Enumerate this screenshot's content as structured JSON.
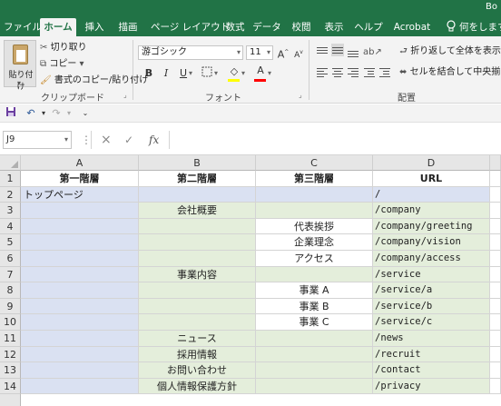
{
  "window": {
    "title": "Bo"
  },
  "tabs": [
    {
      "label": "ファイル"
    },
    {
      "label": "ホーム"
    },
    {
      "label": "挿入"
    },
    {
      "label": "描画"
    },
    {
      "label": "ページ レイアウト"
    },
    {
      "label": "数式"
    },
    {
      "label": "データ"
    },
    {
      "label": "校閲"
    },
    {
      "label": "表示"
    },
    {
      "label": "ヘルプ"
    },
    {
      "label": "Acrobat"
    },
    {
      "label": "何をしますか"
    }
  ],
  "active_tab": "ホーム",
  "ribbon": {
    "clipboard": {
      "paste_label": "貼り付け",
      "cut_label": "切り取り",
      "copy_label": "コピー",
      "format_painter_label": "書式のコピー/貼り付け",
      "group_label": "クリップボード"
    },
    "font": {
      "font_name": "游ゴシック",
      "font_size": "11",
      "bold": "B",
      "italic": "I",
      "underline": "U",
      "grow": "A",
      "shrink": "A",
      "font_color_label": "A",
      "group_label": "フォント",
      "highlight_color": "#ffff00",
      "font_color": "#ff0000"
    },
    "alignment": {
      "wrap_text_label": "折り返して全体を表示す",
      "merge_center_label": "セルを結合して中央揃え",
      "group_label": "配置"
    }
  },
  "formula_bar": {
    "name_box": "J9",
    "fx_label": "fx",
    "cancel_icon": "×",
    "enter_icon": "✓",
    "value": ""
  },
  "sheet": {
    "columns": [
      "A",
      "B",
      "C",
      "D"
    ],
    "rows": [
      "1",
      "2",
      "3",
      "4",
      "5",
      "6",
      "7",
      "8",
      "9",
      "10",
      "11",
      "12",
      "13",
      "14"
    ],
    "header_row": [
      "第一階層",
      "第二階層",
      "第三階層",
      "URL"
    ],
    "data": [
      [
        "トップページ",
        "",
        "",
        "/"
      ],
      [
        "",
        "会社概要",
        "",
        "/company"
      ],
      [
        "",
        "",
        "代表挨拶",
        "/company/greeting"
      ],
      [
        "",
        "",
        "企業理念",
        "/company/vision"
      ],
      [
        "",
        "",
        "アクセス",
        "/company/access"
      ],
      [
        "",
        "事業内容",
        "",
        "/service"
      ],
      [
        "",
        "",
        "事業 A",
        "/service/a"
      ],
      [
        "",
        "",
        "事業 B",
        "/service/b"
      ],
      [
        "",
        "",
        "事業 C",
        "/service/c"
      ],
      [
        "",
        "ニュース",
        "",
        "/news"
      ],
      [
        "",
        "採用情報",
        "",
        "/recruit"
      ],
      [
        "",
        "お問い合わせ",
        "",
        "/contact"
      ],
      [
        "",
        "個人情報保護方針",
        "",
        "/privacy"
      ]
    ],
    "fill_colors": {
      "level1": "#dae1f2",
      "level2": "#e4eedb",
      "level3": "#ffffff",
      "url_row2": "#dae1f2",
      "url_other": "#e4eedb"
    },
    "selected_cell": "J9",
    "theme_color": "#217346"
  }
}
